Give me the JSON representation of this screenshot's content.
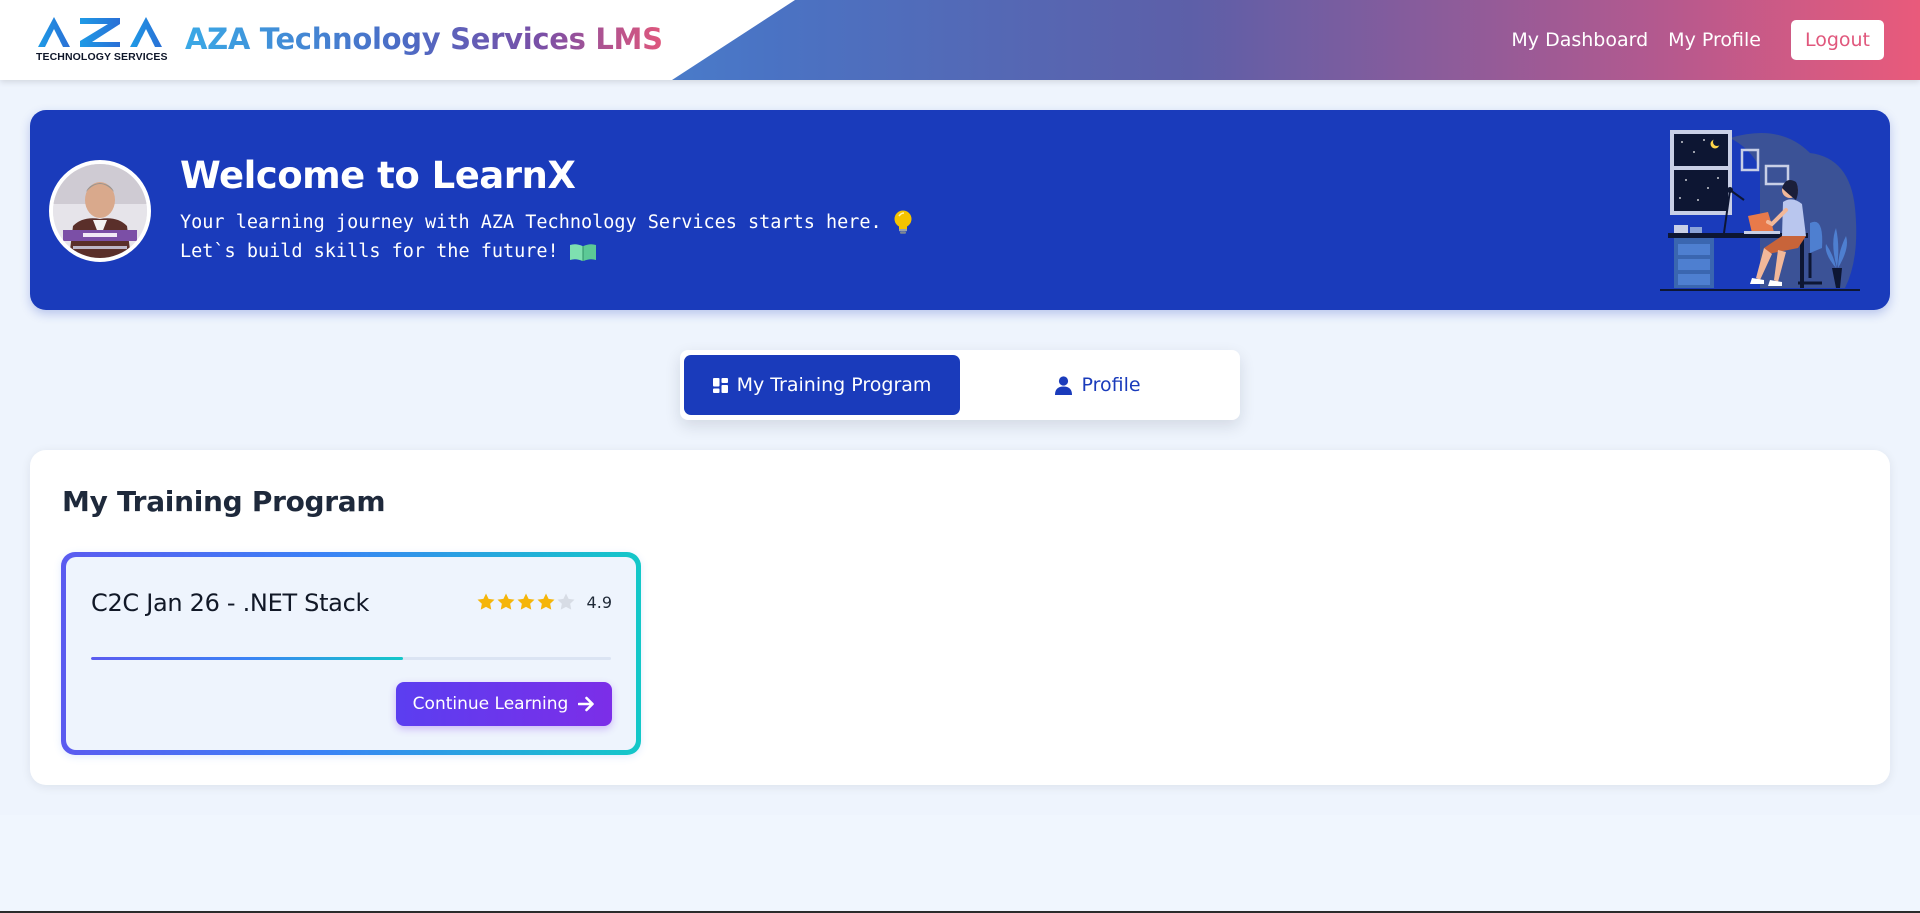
{
  "header": {
    "logo_text": "AZA",
    "logo_subtitle": "TECHNOLOGY SERVICES",
    "app_title": "AZA Technology Services LMS",
    "nav": {
      "dashboard_label": "My Dashboard",
      "profile_label": "My Profile",
      "logout_label": "Logout"
    }
  },
  "banner": {
    "avatar_alt": "User avatar",
    "title": "Welcome to LearnX",
    "line1": "Your learning journey with AZA Technology Services starts here.",
    "line1_icon": "lightbulb-icon",
    "line2": "Let`s build skills for the future!",
    "line2_icon": "open-book-icon",
    "illustration": "person-studying-at-desk-illustration"
  },
  "tabs": [
    {
      "label": "My Training Program",
      "icon": "dashboard-icon",
      "active": true
    },
    {
      "label": "Profile",
      "icon": "user-icon",
      "active": false
    }
  ],
  "program_section": {
    "title": "My Training Program",
    "cards": [
      {
        "name": "C2C Jan 26 - .NET Stack",
        "rating_value": "4.9",
        "stars_filled": 4,
        "stars_total": 5,
        "progress_percent": 60,
        "action_label": "Continue Learning",
        "action_icon": "arrow-right-icon"
      }
    ]
  },
  "colors": {
    "primary": "#1a3bbb",
    "page_background": "#eef4fd",
    "accent_purple": "#7c2ee8",
    "star_gold": "#f5b50a",
    "logout_text": "#e0577c"
  }
}
